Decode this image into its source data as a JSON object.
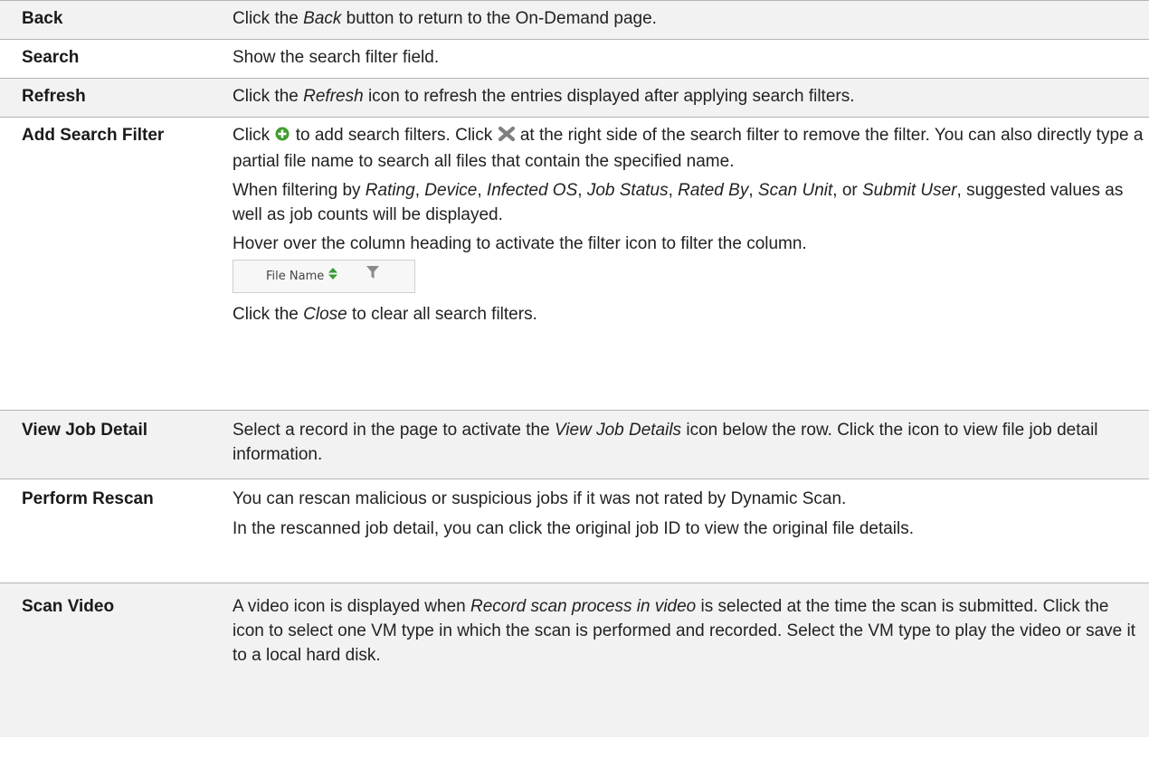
{
  "rows": [
    {
      "term": "Back",
      "desc": [
        "Click the ",
        {
          "i": "Back"
        },
        " button to return to the On-Demand page."
      ]
    },
    {
      "term": "Search",
      "desc": [
        "Show the search filter field."
      ]
    },
    {
      "term": "Refresh",
      "desc": [
        "Click the ",
        {
          "i": "Refresh"
        },
        " icon to refresh the entries displayed after applying search filters."
      ]
    },
    {
      "term": "Add Search Filter"
    },
    {
      "term": "View Job Detail",
      "desc": [
        "Select a record in the page to activate the ",
        {
          "i": "View Job Details"
        },
        " icon below the row. Click the icon to view file job detail information."
      ]
    },
    {
      "term": "Perform Rescan"
    },
    {
      "term": "Scan Video",
      "desc": [
        "A video icon is displayed when ",
        {
          "i": "Record scan process in video"
        },
        " is selected at the time the scan is submitted. Click the icon to select one VM type in which the scan is performed and recorded. Select the VM type to play the video or save it to a local hard disk."
      ]
    }
  ],
  "add_filter": {
    "p1_a": "Click ",
    "p1_b": " to add search filters. Click ",
    "p1_c": " at the right side of the search filter to remove the filter. You can also directly type a partial file name to search all files that contain the specified name.",
    "p2": [
      "When filtering by ",
      {
        "i": "Rating"
      },
      ", ",
      {
        "i": "Device"
      },
      ", ",
      {
        "i": "Infected OS"
      },
      ", ",
      {
        "i": "Job Status"
      },
      ", ",
      {
        "i": "Rated By"
      },
      ", ",
      {
        "i": "Scan Unit"
      },
      ", or ",
      {
        "i": "Submit User"
      },
      ", suggested values as well as job counts will be displayed."
    ],
    "p3": "Hover over the column heading to activate the filter icon to filter the column.",
    "column_heading": "File Name",
    "p4": [
      "Click the ",
      {
        "i": "Close"
      },
      " to clear all search filters."
    ],
    "icons": {
      "add": "add-circle-icon",
      "remove": "remove-x-icon",
      "sort": "sort-icon",
      "filter": "filter-funnel-icon"
    },
    "colors": {
      "add": "#3f9e2d",
      "remove": "#7f7f7f",
      "sort": "#3a9a3a",
      "filter": "#8a8a8a"
    }
  },
  "rescan": {
    "p1": "You can rescan malicious or suspicious jobs if it was not rated by Dynamic Scan.",
    "p2": "In the rescanned job detail, you can click the original job ID to view the original file details."
  }
}
